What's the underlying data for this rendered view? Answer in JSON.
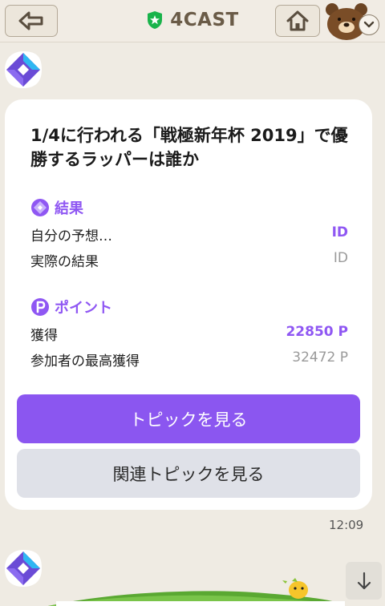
{
  "header": {
    "title": "4CAST",
    "colors": {
      "bg": "#f1ece4",
      "title": "#6a5b47",
      "badge": "#19b34a"
    },
    "icons": {
      "back": "back-arrow-icon",
      "home": "home-icon",
      "account": "bear-avatar",
      "menu": "chevron-down-icon",
      "verified": "verified-star-badge-icon"
    }
  },
  "message": {
    "question": "1/4に行われる「戦極新年杯 2019」で優勝するラッパーは誰か",
    "result_section": {
      "title": "結果",
      "rows": [
        {
          "label": "自分の予想…",
          "value": "ID"
        },
        {
          "label": "実際の結果",
          "value": "ID"
        }
      ]
    },
    "points_section": {
      "title": "ポイント",
      "rows": [
        {
          "label": "獲得",
          "value": "22850 P"
        },
        {
          "label": "参加者の最高獲得",
          "value": "32472 P"
        }
      ]
    },
    "buttons": {
      "view_topic": "トピックを見る",
      "view_related": "関連トピックを見る"
    },
    "time": "12:09",
    "colors": {
      "accent": "#8f57f3",
      "primary_button": "#8b56f0",
      "secondary_button": "#dfe1e8"
    }
  },
  "footer": {
    "scroll_icon": "arrow-down-icon"
  }
}
